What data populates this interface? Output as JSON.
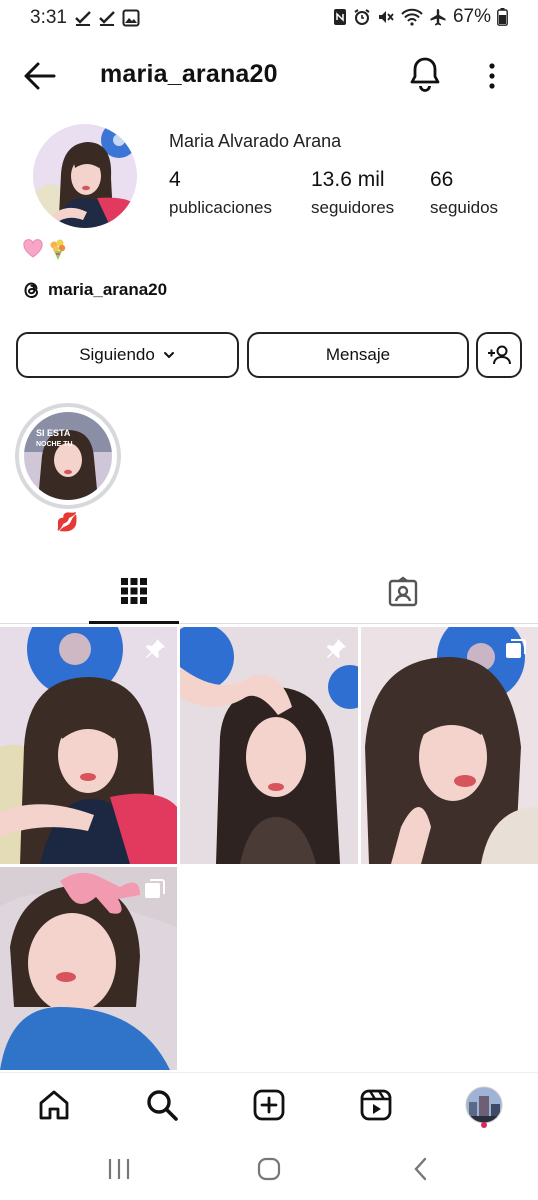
{
  "status_bar": {
    "time": "3:31",
    "battery": "67%",
    "left_icons": [
      "check-icon",
      "check-icon",
      "image-icon"
    ],
    "right_icons": [
      "nfc-icon",
      "alarm-icon",
      "mute-icon",
      "wifi-icon",
      "airplane-icon",
      "battery-icon"
    ]
  },
  "header": {
    "username": "maria_arana20",
    "back_icon": "arrow-left-icon",
    "bell_icon": "bell-icon",
    "more_icon": "more-vertical-icon"
  },
  "profile": {
    "full_name": "Maria Alvarado Arana",
    "stats": [
      {
        "value": "4",
        "label": "publicaciones"
      },
      {
        "value": "13.6 mil",
        "label": "seguidores"
      },
      {
        "value": "66",
        "label": "seguidos"
      }
    ],
    "bio_emoji": [
      "🩷",
      "💐"
    ],
    "threads_handle": "maria_arana20"
  },
  "actions": {
    "following_label": "Siguiendo",
    "message_label": "Mensaje",
    "add_user_icon": "add-person-icon"
  },
  "highlight": {
    "label": "💋",
    "cover_text_line1": "SI ESTA",
    "cover_text_line2": "NOCHE TU"
  },
  "tabs": [
    "grid-icon",
    "tagged-icon"
  ],
  "posts": [
    {
      "badge": "pin-icon"
    },
    {
      "badge": "pin-icon"
    },
    {
      "badge": "carousel-icon"
    },
    {
      "badge": "carousel-icon"
    }
  ],
  "bottom_nav": [
    "home-icon",
    "search-icon",
    "add-post-icon",
    "reels-icon",
    "profile-avatar"
  ],
  "colors": {
    "text": "#111111",
    "border": "#222222",
    "ring": "#d7d9dc",
    "notification_dot": "#e0245e",
    "photo_flower_blue": "#2f6fd1",
    "photo_pink_jacket": "#e23a5e"
  }
}
